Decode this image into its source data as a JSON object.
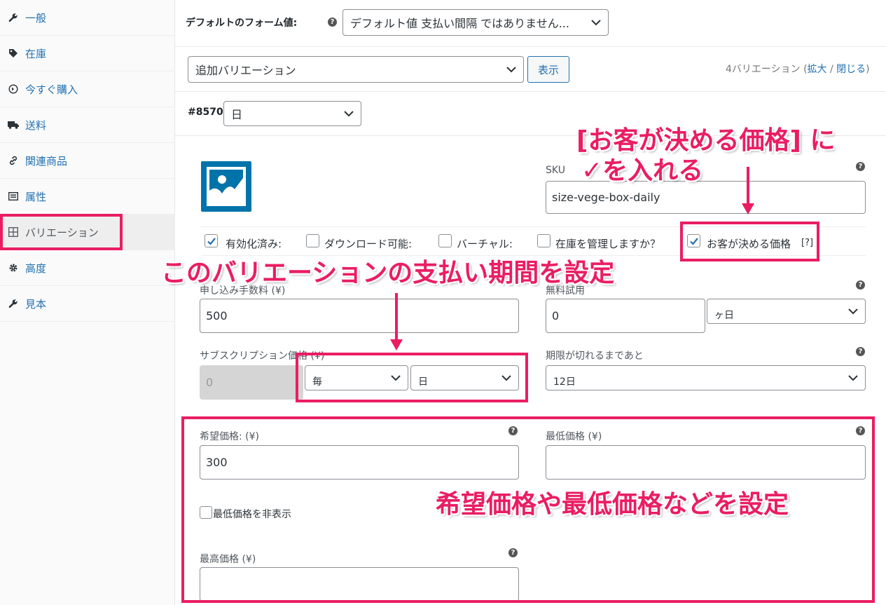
{
  "sidebar": {
    "items": [
      {
        "label": "一般",
        "icon": "wrench-icon"
      },
      {
        "label": "在庫",
        "icon": "tag-icon"
      },
      {
        "label": "今すぐ購入",
        "icon": "circle-arrow-icon"
      },
      {
        "label": "送料",
        "icon": "truck-icon"
      },
      {
        "label": "関連商品",
        "icon": "link-icon"
      },
      {
        "label": "属性",
        "icon": "list-icon"
      },
      {
        "label": "バリエーション",
        "icon": "grid-icon"
      },
      {
        "label": "高度",
        "icon": "gear-icon"
      },
      {
        "label": "見本",
        "icon": "wrench-icon"
      }
    ]
  },
  "defaults": {
    "label": "デフォルトのフォーム値:",
    "select_value": "デフォルト値 支払い間隔 ではありません..."
  },
  "variation_bar": {
    "add_select": "追加バリエーション",
    "show_button": "表示",
    "count_text": "4バリエーション (",
    "expand": "拡大",
    "sep": " / ",
    "close": "閉じる",
    "close_paren": ")"
  },
  "variation": {
    "id": "#8570",
    "attr_value": "日",
    "sku_label": "SKU",
    "sku_value": "size-vege-box-daily",
    "checkboxes": {
      "enabled": {
        "label": "有効化済み:",
        "checked": true
      },
      "downloadable": {
        "label": "ダウンロード可能:",
        "checked": false
      },
      "virtual": {
        "label": "バーチャル:",
        "checked": false
      },
      "manage_stock": {
        "label": "在庫を管理しますか？",
        "checked": false
      },
      "nyp": {
        "label": "お客が決める価格",
        "help": "[?]",
        "checked": true
      }
    },
    "signup_fee_label": "申し込み手数料 (¥)",
    "signup_fee_value": "500",
    "trial_label": "無料試用",
    "trial_value": "0",
    "trial_period": "ヶ日",
    "sub_price_label": "サブスクリプション価格 (¥)",
    "sub_price_value": "0",
    "interval": "毎",
    "period": "日",
    "expire_label": "期限が切れるまであと",
    "expire_value": "12日",
    "suggested_label": "希望価格: (¥)",
    "suggested_value": "300",
    "min_label": "最低価格 (¥)",
    "min_value": "",
    "hide_min_label": "最低価格を非表示",
    "max_label": "最高価格 (¥)",
    "max_value": ""
  },
  "annotations": {
    "nyp_line1": "[お客が決める価格] に",
    "nyp_line2": "✓を入れる",
    "period": "このバリエーションの支払い期間を設定",
    "price": "希望価格や最低価格などを設定"
  },
  "colors": {
    "accent": "#2271b1",
    "annotation": "#ea1d63",
    "logo": "#0073aa"
  }
}
